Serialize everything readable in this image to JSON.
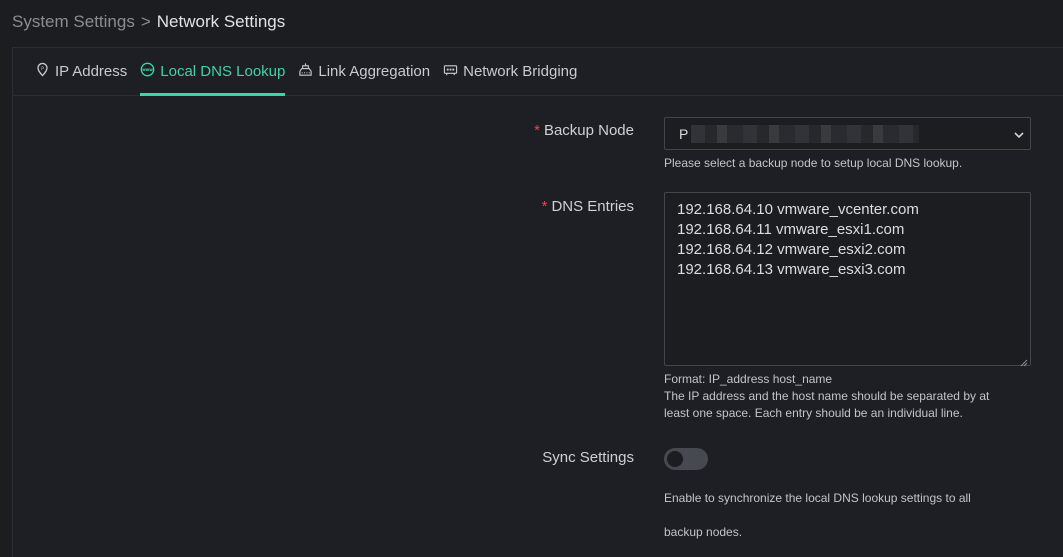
{
  "breadcrumb": {
    "parent": "System Settings",
    "separator": ">",
    "current": "Network Settings"
  },
  "tabs": [
    {
      "label": "IP Address",
      "icon": "location-pin-icon",
      "active": false
    },
    {
      "label": "Local DNS Lookup",
      "icon": "www-icon",
      "active": true
    },
    {
      "label": "Link Aggregation",
      "icon": "network-hub-icon",
      "active": false
    },
    {
      "label": "Network Bridging",
      "icon": "bridge-icon",
      "active": false
    }
  ],
  "form": {
    "required_mark": "*",
    "backup_node": {
      "label": "Backup Node",
      "value": "P",
      "hint": "Please select a backup node to setup local DNS lookup."
    },
    "dns_entries": {
      "label": "DNS Entries",
      "lines": [
        "192.168.64.10 vmware_vcenter.com",
        "192.168.64.11 vmware_esxi1.com",
        "192.168.64.12 vmware_esxi2.com",
        "192.168.64.13 vmware_esxi3.com"
      ],
      "hint_format": "Format: IP_address host_name",
      "hint_line2": "The IP address and the host name should be separated by at",
      "hint_line3": "least one space. Each entry should be an individual line."
    },
    "sync": {
      "label": "Sync Settings",
      "enabled": false,
      "hint_line1": "Enable to synchronize the local DNS lookup settings to all",
      "hint_line2": "backup nodes."
    }
  },
  "colors": {
    "accent": "#3fd3a7",
    "required": "#e5484d",
    "background": "#1c1d21"
  }
}
